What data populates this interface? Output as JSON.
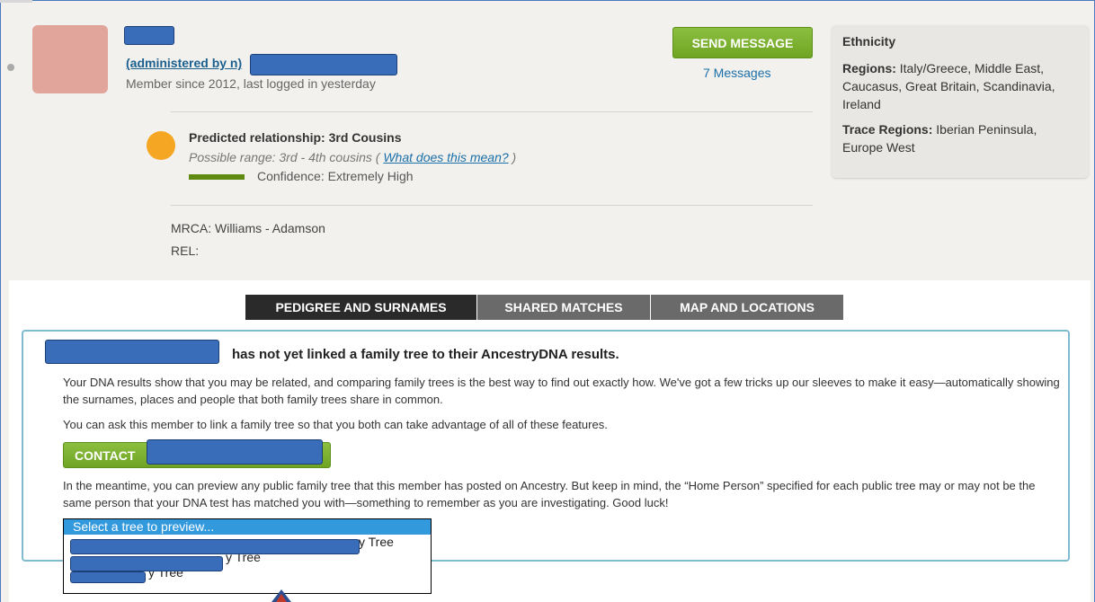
{
  "profile": {
    "admin_text": "(administered by                                     n)",
    "member_since": "Member since 2012, last logged in yesterday",
    "send_message_label": "SEND MESSAGE",
    "messages_link": "7 Messages"
  },
  "relationship": {
    "title": "Predicted relationship: 3rd Cousins",
    "range_text": "Possible range: 3rd - 4th cousins ( ",
    "range_link": "What does this mean?",
    "range_close": " )",
    "confidence": "Confidence: Extremely High"
  },
  "notes": {
    "mrca": "MRCA: Williams - Adamson",
    "rel": "REL:"
  },
  "ethnicity": {
    "title": "Ethnicity",
    "regions_label": "Regions:",
    "regions_value": " Italy/Greece, Middle East, Caucasus, Great Britain, Scandinavia, Ireland",
    "trace_label": "Trace Regions:",
    "trace_value": " Iberian Peninsula, Europe West"
  },
  "tabs": [
    {
      "label": "PEDIGREE AND SURNAMES"
    },
    {
      "label": "SHARED MATCHES"
    },
    {
      "label": "MAP AND LOCATIONS"
    }
  ],
  "tree_notice": {
    "title": "has not yet linked a family tree to their AncestryDNA results.",
    "para1": "Your DNA results show that you may be related, and comparing family trees is the best way to find out exactly how. We've got a few tricks up our sleeves to make it easy—automatically showing the surnames, places and people that both family trees share in common.",
    "para2": "You can ask this member to link a family tree so that you both can take advantage of all of these features.",
    "contact_label": "CONTACT",
    "para3": "In the meantime, you can preview any public family tree that this member has posted on Ancestry. But keep in mind, the “Home Person” specified for each public tree may or may not be the same person that your DNA test has matched you with—something to remember as you are investigating. Good luck!",
    "select_placeholder": "Select a tree to preview...",
    "options": [
      "y Tree",
      "y Tree",
      "y Tree"
    ]
  }
}
